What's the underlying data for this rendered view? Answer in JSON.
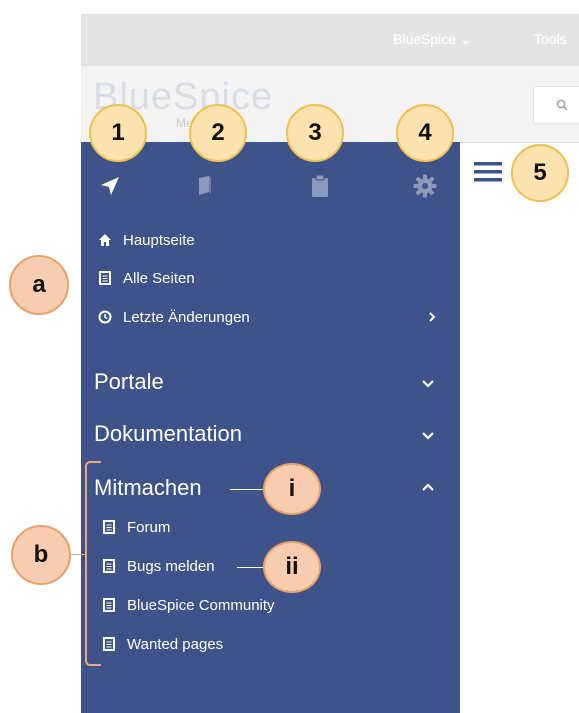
{
  "topbar": {
    "menu1": "BlueSpice ⌄",
    "menu2": "Tools"
  },
  "header": {
    "logo_text": "BlueSpice",
    "logo_sub": "MediaWiki"
  },
  "sidebar": {
    "tabs": [
      {
        "icon": "navigation-arrow-icon"
      },
      {
        "icon": "book-icon"
      },
      {
        "icon": "clipboard-icon"
      },
      {
        "icon": "gear-icon"
      }
    ],
    "nav": [
      {
        "label": "Hauptseite",
        "icon": "home-icon"
      },
      {
        "label": "Alle Seiten",
        "icon": "page-icon"
      },
      {
        "label": "Letzte Änderungen",
        "icon": "clock-icon"
      }
    ],
    "sections": {
      "portale": "Portale",
      "dokumentation": "Dokumentation",
      "mitmachen": "Mitmachen"
    },
    "mitmachen_items": [
      {
        "label": "Forum"
      },
      {
        "label": "Bugs melden"
      },
      {
        "label": "BlueSpice Community"
      },
      {
        "label": "Wanted pages"
      }
    ]
  },
  "annotations": {
    "n1": "1",
    "n2": "2",
    "n3": "3",
    "n4": "4",
    "n5": "5",
    "a": "a",
    "b": "b",
    "i": "i",
    "ii": "ii"
  },
  "colors": {
    "sidebar_bg": "#3e5389",
    "badge_yellow": "#fbe2ae",
    "badge_peach": "#f8ccae",
    "hamburger": "#3e5389"
  }
}
